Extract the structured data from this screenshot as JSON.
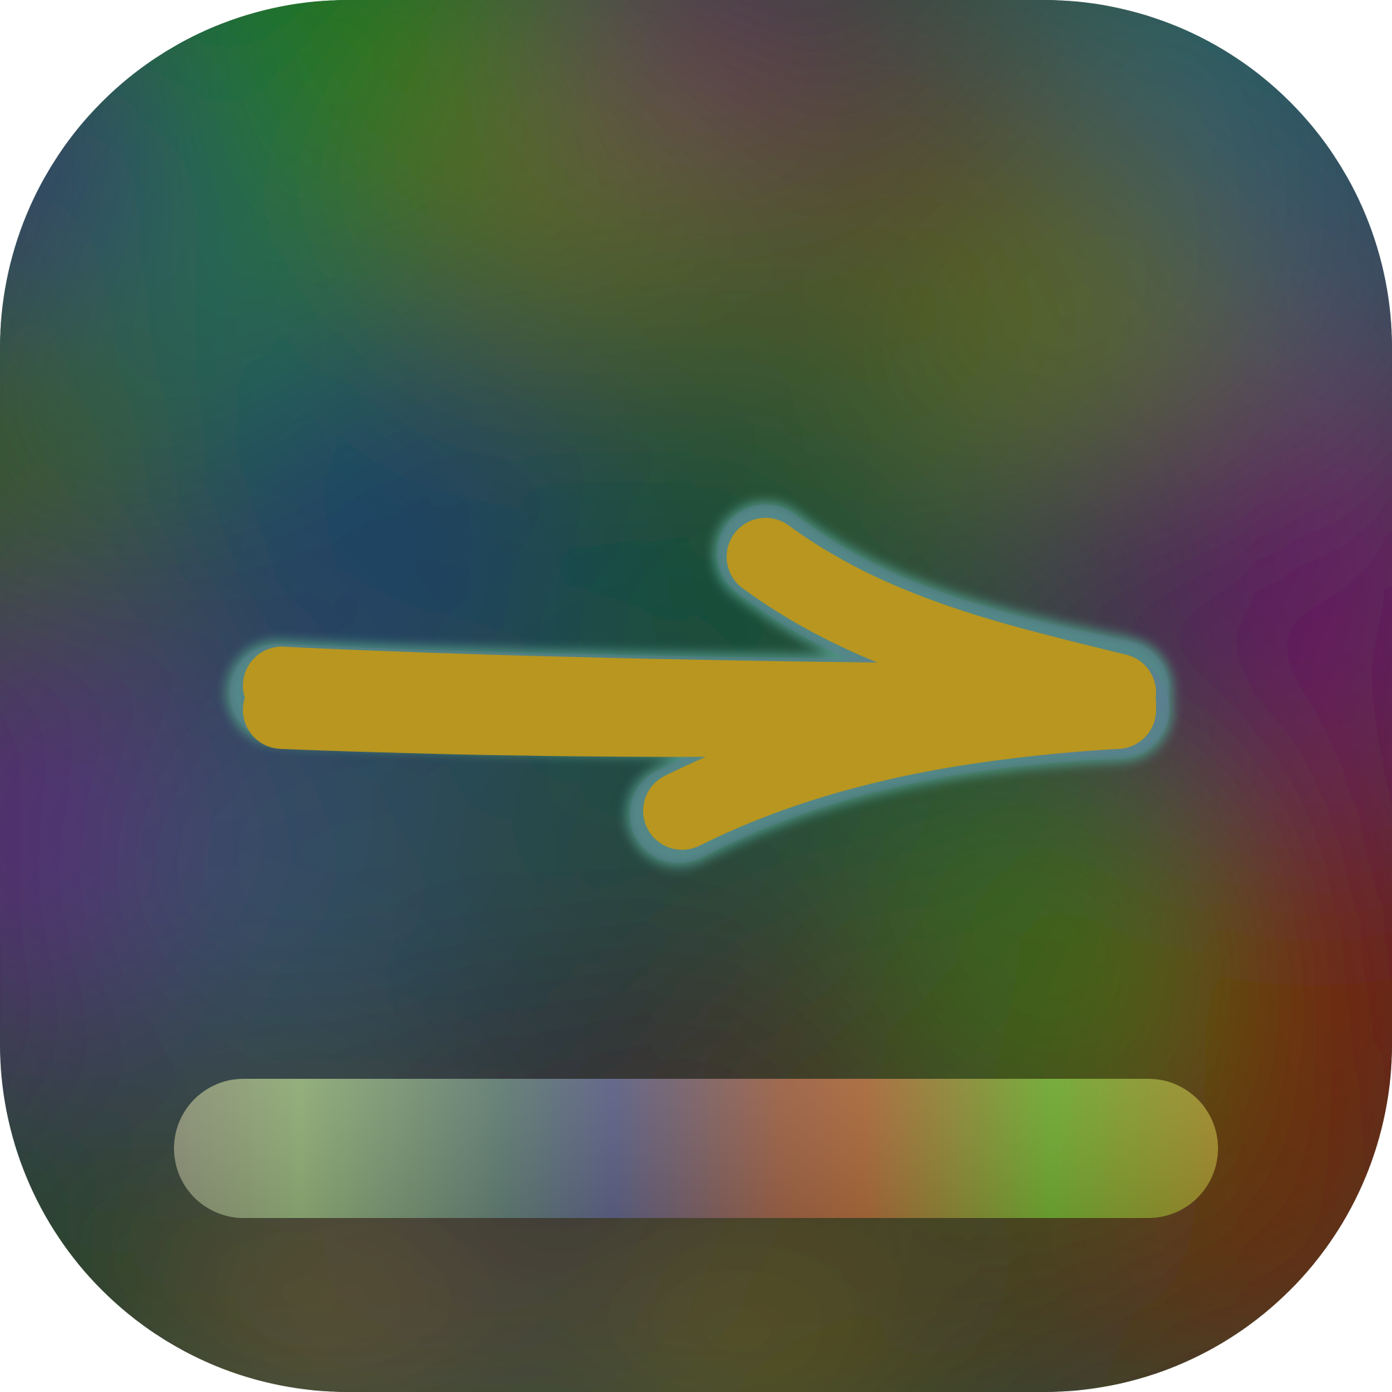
{
  "icon": {
    "name": "right-arrow-app-icon",
    "glyphs": [
      "arrow-right-icon",
      "baseline-bar"
    ],
    "colors": {
      "arrow_fill": "#b8961f",
      "arrow_glow": "#4f9a86",
      "bar_left": "#8fae77",
      "bar_mid": "#5c6384",
      "bar_right": "#a8662f",
      "bar_far_right": "#76b02c",
      "background": [
        "#0d6a20",
        "#1f4b63",
        "#5a1c70",
        "#6e0d0b",
        "#3c5c19"
      ]
    }
  }
}
